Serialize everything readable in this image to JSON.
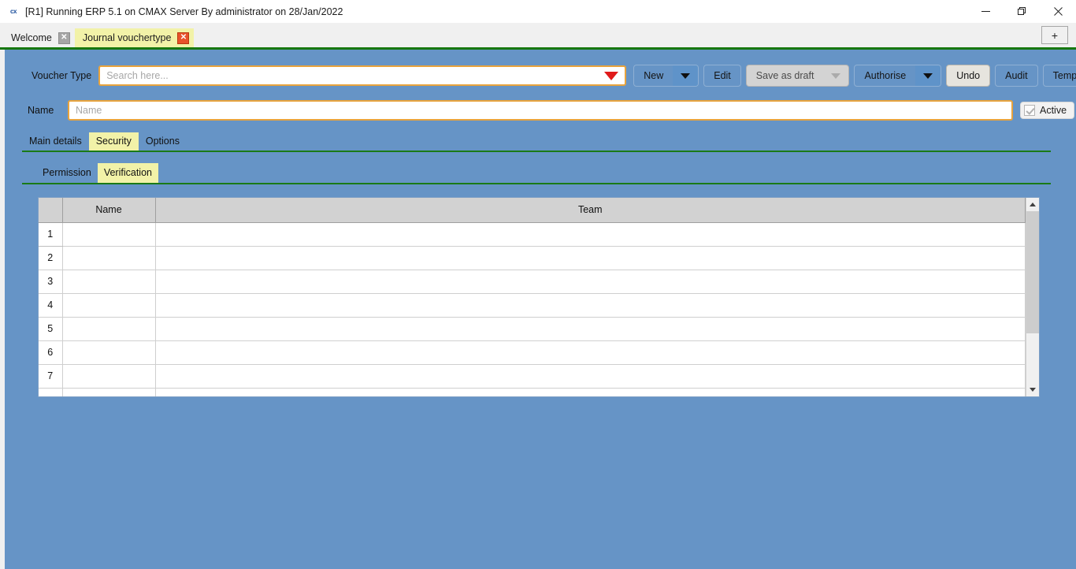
{
  "window": {
    "title": "[R1] Running ERP 5.1 on CMAX Server By administrator on 28/Jan/2022",
    "app_icon": "cx",
    "controls": {
      "minimize": "—",
      "maximize": "❐",
      "close": "✕"
    }
  },
  "tabstrip": {
    "tabs": [
      {
        "label": "Welcome",
        "close": "✕",
        "active": false
      },
      {
        "label": "Journal vouchertype",
        "close": "✕",
        "active": true
      }
    ],
    "new_tab": "+"
  },
  "form": {
    "voucher_type_label": "Voucher Type",
    "search_value": "",
    "search_placeholder": "Search here...",
    "name_label": "Name",
    "name_value": "",
    "name_placeholder": "Name",
    "active_label": "Active",
    "active_checked": true
  },
  "toolbar": {
    "new_label": "New",
    "edit_label": "Edit",
    "save_as_draft_label": "Save as draft",
    "authorise_label": "Authorise",
    "undo_label": "Undo",
    "audit_label": "Audit",
    "template_label": "Template"
  },
  "tabs_main": [
    {
      "label": "Main details",
      "active": false
    },
    {
      "label": "Security",
      "active": true
    },
    {
      "label": "Options",
      "active": false
    }
  ],
  "tabs_sub": [
    {
      "label": "Permission",
      "active": false
    },
    {
      "label": "Verification",
      "active": true
    }
  ],
  "grid": {
    "columns": [
      "",
      "Name",
      "Team"
    ],
    "rows": [
      {
        "num": "1",
        "name": "",
        "team": ""
      },
      {
        "num": "2",
        "name": "",
        "team": ""
      },
      {
        "num": "3",
        "name": "",
        "team": ""
      },
      {
        "num": "4",
        "name": "",
        "team": ""
      },
      {
        "num": "5",
        "name": "",
        "team": ""
      },
      {
        "num": "6",
        "name": "",
        "team": ""
      },
      {
        "num": "7",
        "name": "",
        "team": ""
      }
    ]
  },
  "colors": {
    "canvas_blue": "#6694c6",
    "tab_active_yellow": "#f2f2a8",
    "rule_green": "#1a7a16",
    "input_border_gold": "#e8a33d",
    "caret_red": "#e01b1b",
    "header_gray": "#d2d2d2"
  }
}
